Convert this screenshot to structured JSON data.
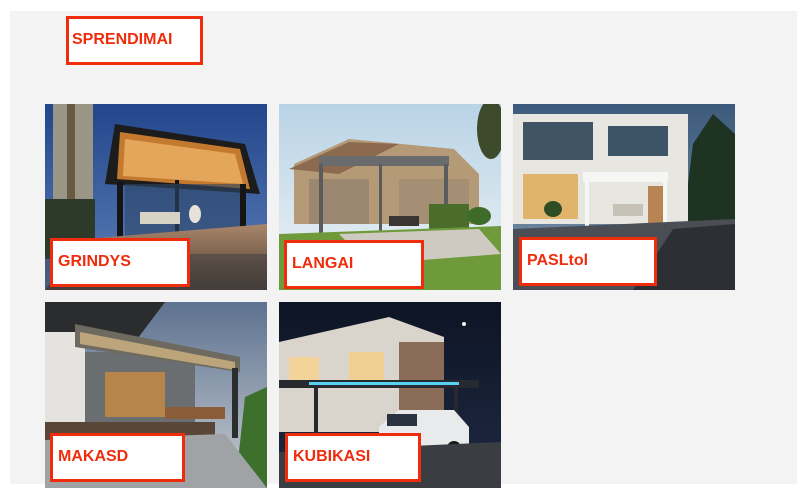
{
  "section": {
    "title": "SPRENDIMAI"
  },
  "tiles": [
    {
      "label": "GRINDYS",
      "image": "illuminated glass pergola at dusk"
    },
    {
      "label": "LANGAI",
      "image": "grey pergola beside stone house with lawn"
    },
    {
      "label": "PASLtol",
      "image": "white pergola in front of modern villa at night"
    },
    {
      "label": "MAKASD",
      "image": "retractable roof pergola on patio at dusk"
    },
    {
      "label": "KUBIKASI",
      "image": "LED lit carport pergola with white car at night"
    }
  ],
  "colors": {
    "accent": "#ef2d0c",
    "panel": "#f3f3f3"
  }
}
